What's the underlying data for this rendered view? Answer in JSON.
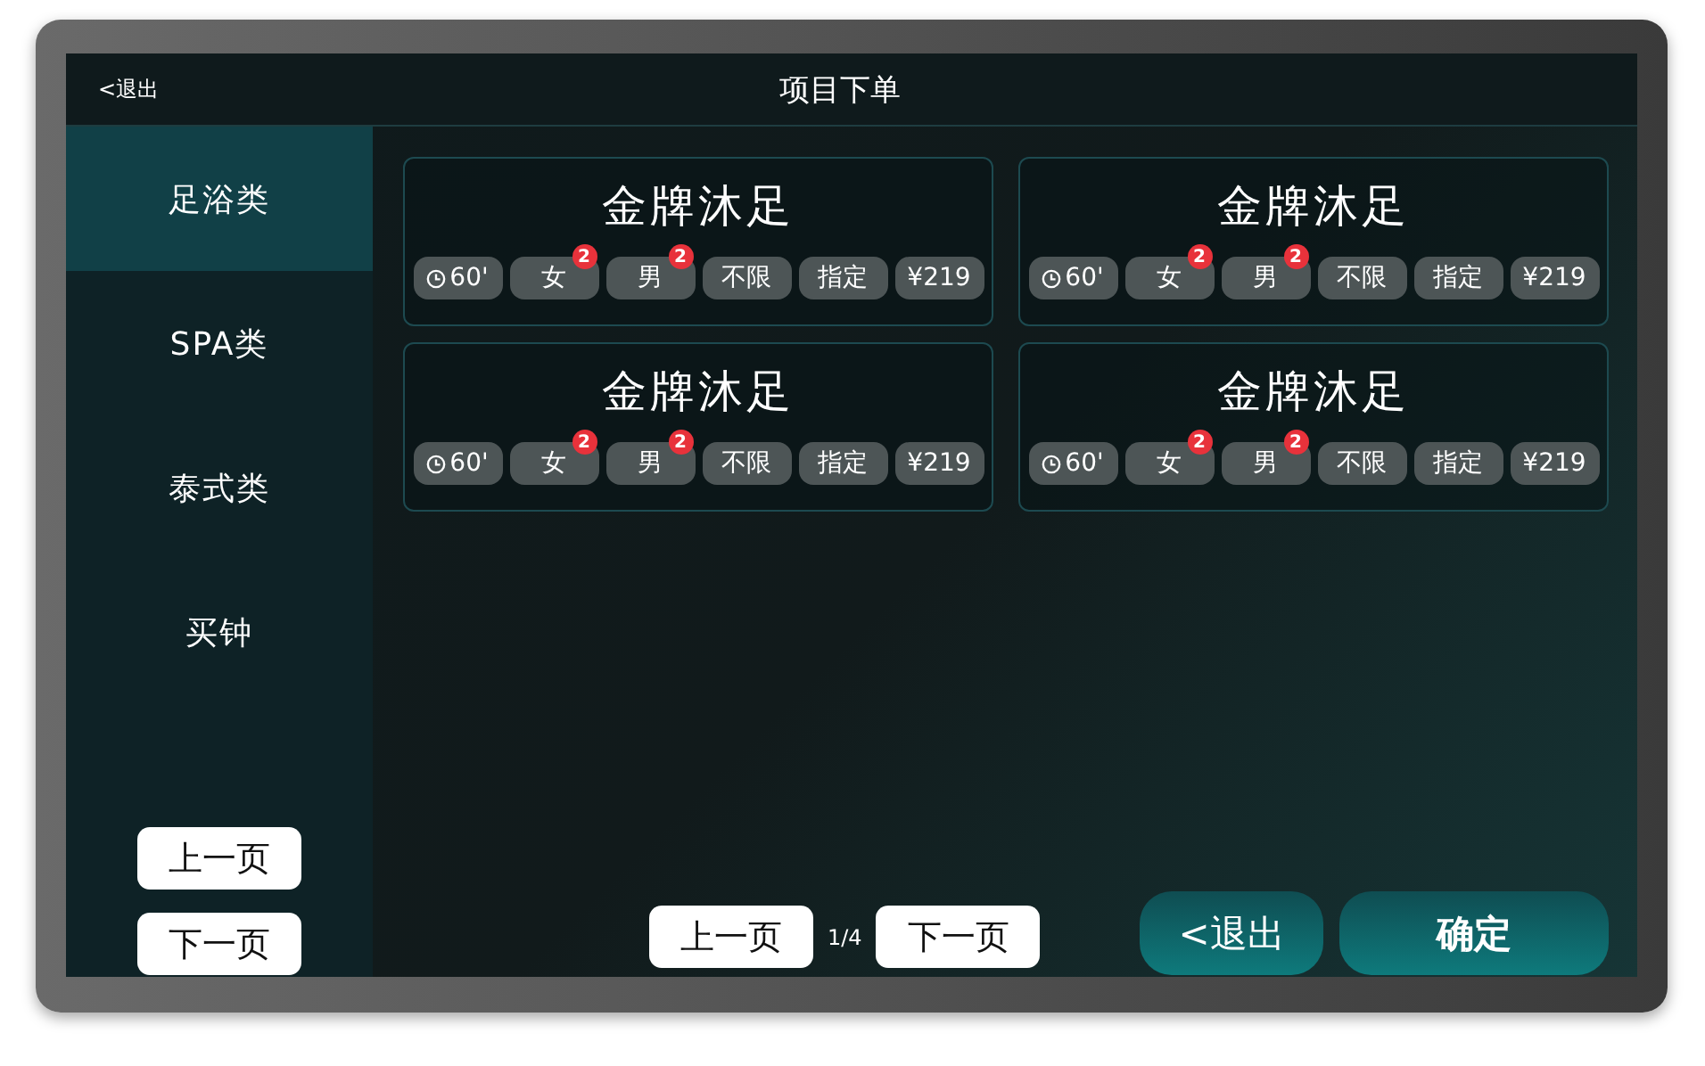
{
  "header": {
    "back": "<退出",
    "title": "项目下单"
  },
  "categories": [
    {
      "label": "足浴类",
      "selected": true
    },
    {
      "label": "SPA类",
      "selected": false
    },
    {
      "label": "泰式类",
      "selected": false
    },
    {
      "label": "买钟",
      "selected": false
    }
  ],
  "cards": [
    {
      "name": "金牌沐足",
      "chips": [
        {
          "kind": "duration",
          "label": "60'"
        },
        {
          "kind": "gender",
          "label": "女",
          "badge": "2"
        },
        {
          "kind": "gender",
          "label": "男",
          "badge": "2"
        },
        {
          "kind": "option",
          "label": "不限"
        },
        {
          "kind": "option",
          "label": "指定"
        },
        {
          "kind": "price",
          "label": "¥219"
        }
      ]
    },
    {
      "name": "金牌沐足",
      "chips": [
        {
          "kind": "duration",
          "label": "60'"
        },
        {
          "kind": "gender",
          "label": "女",
          "badge": "2"
        },
        {
          "kind": "gender",
          "label": "男",
          "badge": "2"
        },
        {
          "kind": "option",
          "label": "不限"
        },
        {
          "kind": "option",
          "label": "指定"
        },
        {
          "kind": "price",
          "label": "¥219"
        }
      ]
    },
    {
      "name": "金牌沐足",
      "chips": [
        {
          "kind": "duration",
          "label": "60'"
        },
        {
          "kind": "gender",
          "label": "女",
          "badge": "2"
        },
        {
          "kind": "gender",
          "label": "男",
          "badge": "2"
        },
        {
          "kind": "option",
          "label": "不限"
        },
        {
          "kind": "option",
          "label": "指定"
        },
        {
          "kind": "price",
          "label": "¥219"
        }
      ]
    },
    {
      "name": "金牌沐足",
      "chips": [
        {
          "kind": "duration",
          "label": "60'"
        },
        {
          "kind": "gender",
          "label": "女",
          "badge": "2"
        },
        {
          "kind": "gender",
          "label": "男",
          "badge": "2"
        },
        {
          "kind": "option",
          "label": "不限"
        },
        {
          "kind": "option",
          "label": "指定"
        },
        {
          "kind": "price",
          "label": "¥219"
        }
      ]
    }
  ],
  "sidebar_pager": {
    "prev": "上一页",
    "next": "下一页"
  },
  "pager": {
    "prev": "上一页",
    "page": "1/4",
    "next": "下一页"
  },
  "buttons": [
    {
      "kind": "secondary",
      "label": "<退出"
    },
    {
      "kind": "primary",
      "label": "确定"
    }
  ]
}
